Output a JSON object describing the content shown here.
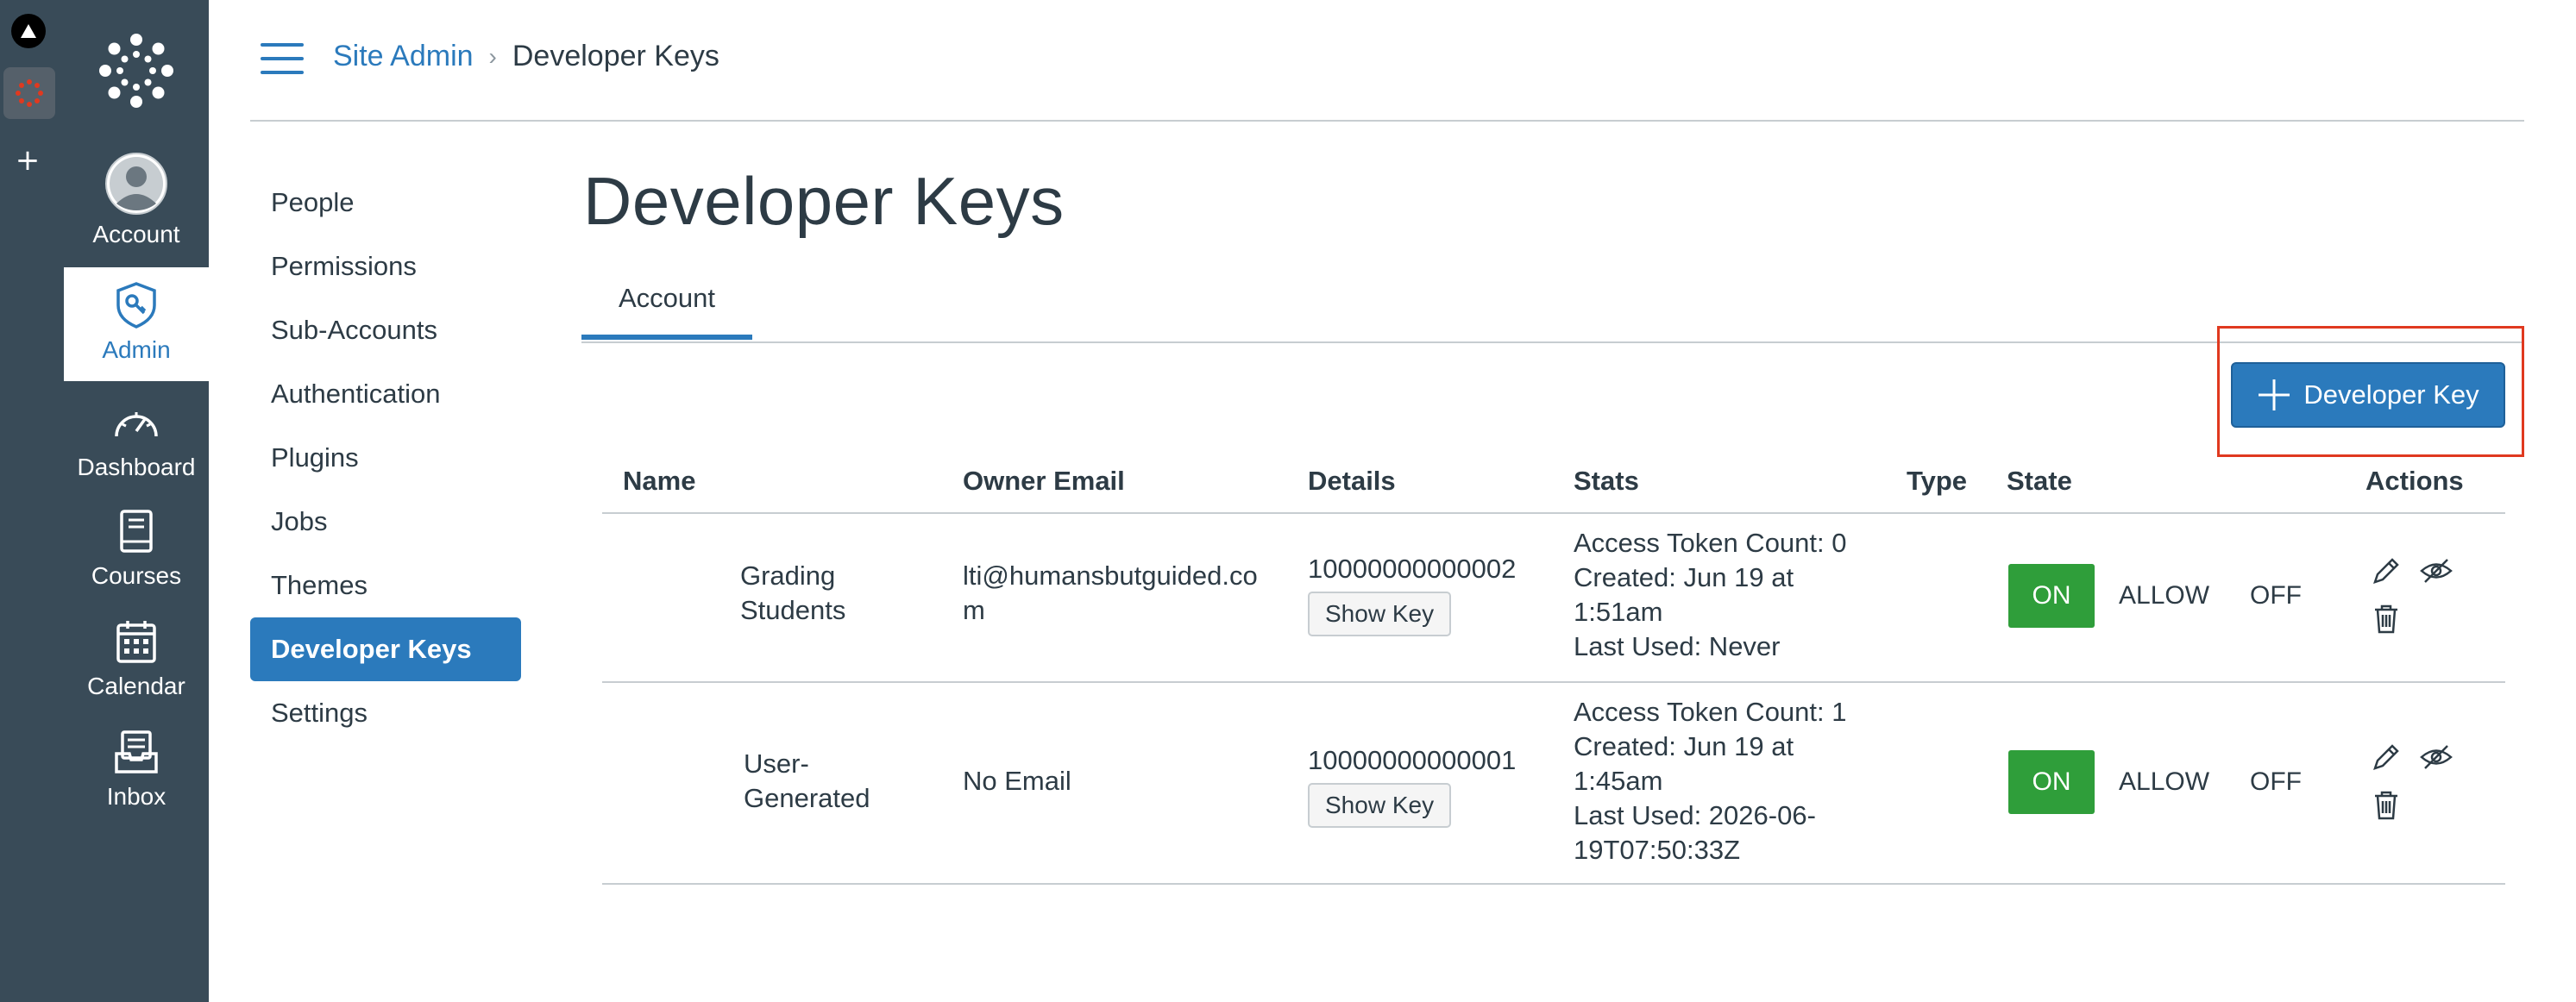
{
  "header": {
    "breadcrumb_root": "Site Admin",
    "breadcrumb_separator": "›",
    "breadcrumb_current": "Developer Keys"
  },
  "global_nav": {
    "items": [
      {
        "label": "Account",
        "icon": "avatar-icon"
      },
      {
        "label": "Admin",
        "icon": "shield-key-icon"
      },
      {
        "label": "Dashboard",
        "icon": "dashboard-icon"
      },
      {
        "label": "Courses",
        "icon": "book-icon"
      },
      {
        "label": "Calendar",
        "icon": "calendar-icon"
      },
      {
        "label": "Inbox",
        "icon": "inbox-icon"
      }
    ]
  },
  "sub_nav": {
    "items": [
      "People",
      "Permissions",
      "Sub-Accounts",
      "Authentication",
      "Plugins",
      "Jobs",
      "Themes",
      "Developer Keys",
      "Settings"
    ],
    "active": "Developer Keys"
  },
  "main": {
    "title": "Developer Keys",
    "tabs": [
      "Account"
    ],
    "add_button_label": "Developer Key"
  },
  "table": {
    "columns": [
      "Name",
      "Owner Email",
      "Details",
      "Stats",
      "Type",
      "State",
      "Actions"
    ],
    "rows": [
      {
        "name_1": "Grading",
        "name_2": "Students",
        "email_1": "lti@humansbutguided.co",
        "email_2": "m",
        "id": "10000000000002",
        "show_key": "Show Key",
        "stat_1": "Access Token Count: 0",
        "stat_2": "Created: Jun 19 at",
        "stat_3": "1:51am",
        "stat_4": "Last Used: Never",
        "stat_5": "",
        "state_on": "ON",
        "state_allow": "ALLOW",
        "state_off": "OFF"
      },
      {
        "name_1": "User-",
        "name_2": "Generated",
        "email_1": "No Email",
        "email_2": "",
        "id": "10000000000001",
        "show_key": "Show Key",
        "stat_1": "Access Token Count: 1",
        "stat_2": "Created: Jun 19 at",
        "stat_3": "1:45am",
        "stat_4": "Last Used: 2026-06-",
        "stat_5": "19T07:50:33Z",
        "state_on": "ON",
        "state_allow": "ALLOW",
        "state_off": "OFF"
      }
    ]
  },
  "colors": {
    "nav_bg": "#394b58",
    "accent": "#2b7abc",
    "on_green": "#2f9e3a",
    "highlight_red": "#e0391f"
  }
}
